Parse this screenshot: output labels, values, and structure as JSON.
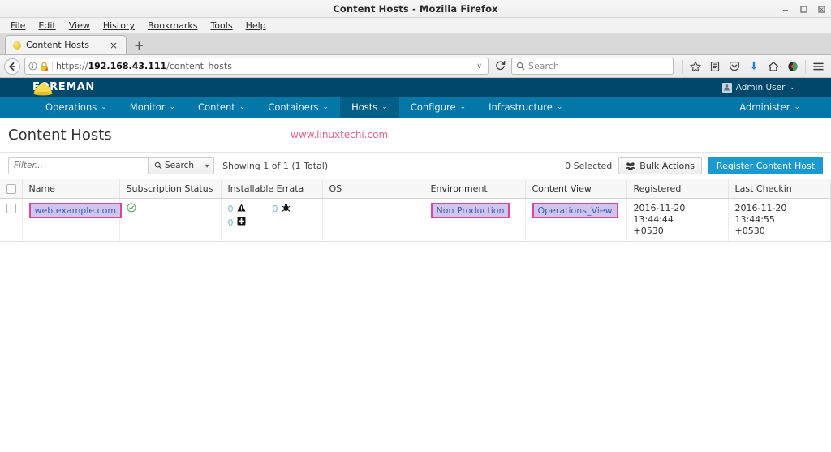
{
  "window": {
    "title": "Content Hosts - Mozilla Firefox",
    "minimize_label": "minimize-icon",
    "maximize_label": "maximize-icon",
    "close_label": "close-icon"
  },
  "menubar": {
    "items": [
      {
        "label": "File",
        "accel": "F"
      },
      {
        "label": "Edit",
        "accel": "E"
      },
      {
        "label": "View",
        "accel": "V"
      },
      {
        "label": "History",
        "accel": "s"
      },
      {
        "label": "Bookmarks",
        "accel": "B"
      },
      {
        "label": "Tools",
        "accel": "T"
      },
      {
        "label": "Help",
        "accel": "H"
      }
    ]
  },
  "tabs": {
    "items": [
      {
        "label": "Content Hosts",
        "favicon": "foreman-favicon",
        "close": "×"
      }
    ],
    "new_tab": "+"
  },
  "browser": {
    "back_icon": "back-arrow-icon",
    "info_icon": "page-info-icon",
    "lock_icon": "lock-warning-icon",
    "url_prefix": "https://",
    "url_host": "192.168.43.111",
    "url_path": "/content_hosts",
    "url_full": "https://192.168.43.111/content_hosts",
    "history_caret": "∨",
    "reload_icon": "reload-icon",
    "search_placeholder": "Search",
    "search_icon": "search-icon",
    "toolbar_icons": [
      "bookmark-star-icon",
      "library-icon",
      "pocket-icon",
      "downloads-icon",
      "home-icon",
      "profile-icon",
      "hamburger-menu-icon"
    ]
  },
  "app_header": {
    "brand": "FOREMAN",
    "logo": "hardhat-logo",
    "user": "Admin User",
    "avatar": "user-avatar-icon",
    "caret": "⌄"
  },
  "app_nav": {
    "items": [
      {
        "label": "Operations",
        "active": false
      },
      {
        "label": "Monitor",
        "active": false
      },
      {
        "label": "Content",
        "active": false
      },
      {
        "label": "Containers",
        "active": false
      },
      {
        "label": "Hosts",
        "active": true
      },
      {
        "label": "Configure",
        "active": false
      },
      {
        "label": "Infrastructure",
        "active": false
      }
    ],
    "right_items": [
      {
        "label": "Administer",
        "active": false
      }
    ],
    "caret": "⌄"
  },
  "page": {
    "title": "Content Hosts",
    "watermark": "www.linuxtechi.com"
  },
  "toolbar": {
    "filter_placeholder": "Filter...",
    "filter_value": "",
    "search_label": "Search",
    "search_icon": "search-icon",
    "search_caret": "▾",
    "showing_text": "Showing 1 of 1 (1 Total)",
    "selected_text": "0 Selected",
    "bulk_actions_label": "Bulk Actions",
    "bulk_actions_icon": "group-icon",
    "register_label": "Register Content Host",
    "accent_color": "#1a9ad0"
  },
  "table": {
    "columns": [
      "Name",
      "Subscription Status",
      "Installable Errata",
      "OS",
      "Environment",
      "Content View",
      "Registered",
      "Last Checkin"
    ],
    "rows": [
      {
        "selected": false,
        "name": "web.example.com",
        "name_highlighted": true,
        "subscription_status": "valid",
        "subscription_status_icon": "check-circle-icon",
        "errata": [
          {
            "count": "0",
            "icon": "security-errata-icon"
          },
          {
            "count": "0",
            "icon": "bugfix-errata-icon"
          },
          {
            "count": "0",
            "icon": "enhancement-errata-icon"
          }
        ],
        "os": "",
        "environment": "Non Production",
        "environment_highlighted": true,
        "content_view": "Operations_View",
        "content_view_highlighted": true,
        "registered_date": "2016-11-20 13:44:44",
        "registered_tz": "+0530",
        "last_checkin_date": "2016-11-20 13:44:55",
        "last_checkin_tz": "+0530"
      }
    ]
  },
  "highlight": {
    "border_color": "#e0449a",
    "fill_color": "#cfc6f0"
  }
}
